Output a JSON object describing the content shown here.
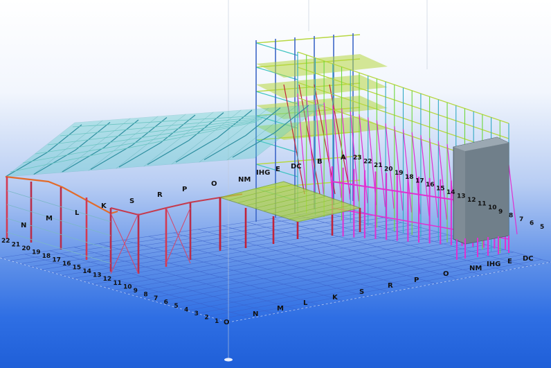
{
  "viewport": {
    "background_top": "#ffffff",
    "background_bottom": "#1f5fd8",
    "grid_color": "#3a5fc9",
    "column_red": "#c0223a",
    "column_magenta": "#e030d0",
    "beam_green": "#b7d740",
    "roof_cyan": "#5ad0c8",
    "panel_gray": "#7f8c96"
  },
  "grid_labels": {
    "front_letters": [
      "O",
      "N",
      "M",
      "L",
      "K",
      "S",
      "R",
      "P",
      "O",
      "NM",
      "IHG",
      "E",
      "DC"
    ],
    "front_numbers": [
      "22",
      "21",
      "20",
      "19",
      "18",
      "17",
      "16",
      "15",
      "14",
      "13",
      "12",
      "11",
      "10",
      "9",
      "8",
      "7",
      "6",
      "5",
      "4",
      "3",
      "2",
      "1"
    ],
    "upper_letters": [
      "N",
      "M",
      "L",
      "K",
      "S",
      "R",
      "P",
      "O",
      "NM",
      "IHG",
      "E",
      "DC",
      "B",
      "A"
    ],
    "right_numbers": [
      "23",
      "22",
      "21",
      "20",
      "19",
      "18",
      "17",
      "16",
      "15",
      "14",
      "13",
      "12",
      "11",
      "10",
      "9",
      "8",
      "7",
      "6",
      "5"
    ]
  }
}
